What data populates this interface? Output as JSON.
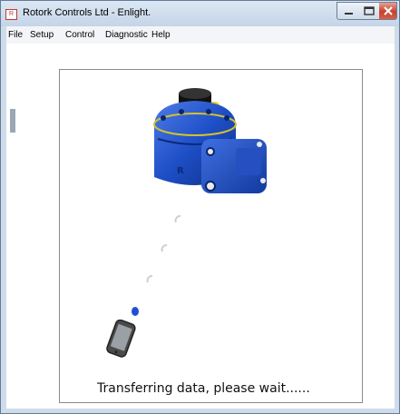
{
  "window": {
    "title": "Rotork Controls Ltd - Enlight.",
    "app_icon_text": "R"
  },
  "menu": {
    "items": [
      "File",
      "Setup",
      "Control",
      "Diagnostic",
      "Help"
    ]
  },
  "status": {
    "message": "Transferring data, please wait......"
  },
  "colors": {
    "actuator_blue": "#1e4fc7",
    "progress_active": "#1f4fd8",
    "progress_idle": "#cfcfcf"
  }
}
